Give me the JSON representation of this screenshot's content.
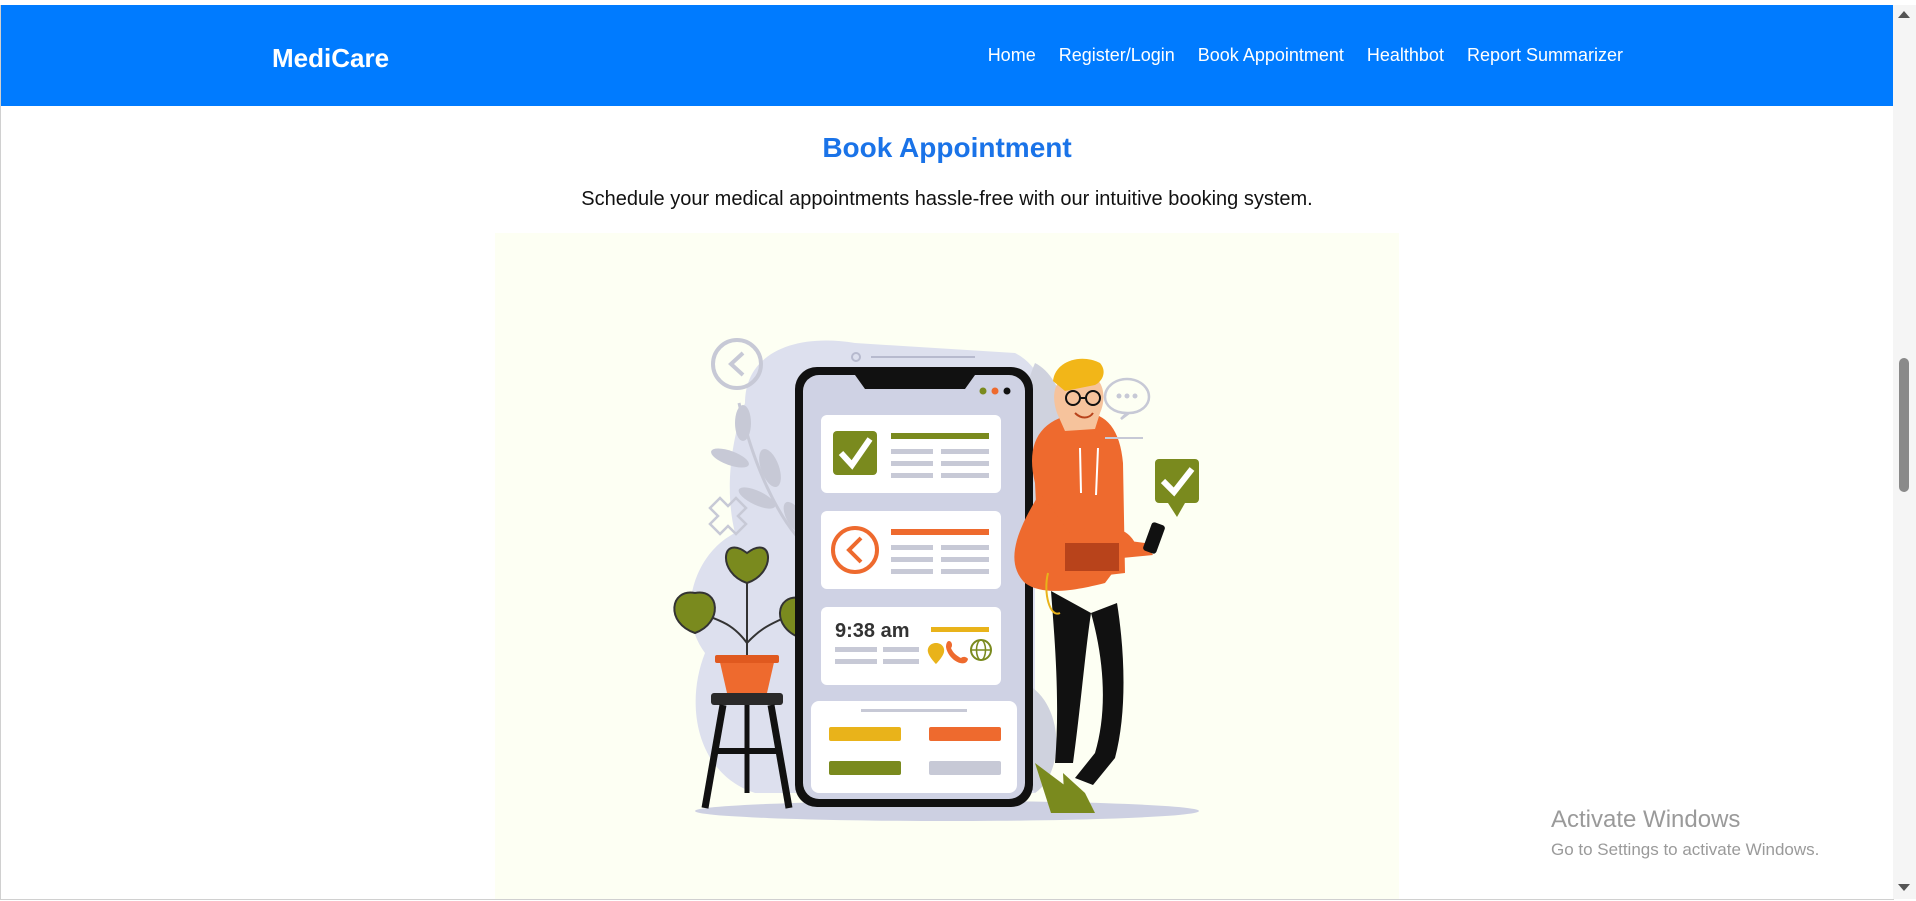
{
  "navbar": {
    "brand": "MediCare",
    "links": [
      "Home",
      "Register/Login",
      "Book Appointment",
      "Healthbot",
      "Report Summarizer"
    ]
  },
  "main": {
    "title": "Book Appointment",
    "subtitle": "Schedule your medical appointments hassle-free with our intuitive booking system."
  },
  "illustration": {
    "time_label": "9:38 am",
    "icons": [
      "clock-icon",
      "checkmark-icon",
      "location-pin-icon",
      "phone-icon",
      "globe-icon",
      "chat-bubble-icon",
      "plant-icon"
    ]
  },
  "watermark": {
    "title": "Activate Windows",
    "subtitle": "Go to Settings to activate Windows."
  },
  "colors": {
    "navbar": "#007bff",
    "title": "#1a73e8",
    "illustration_bg": "#fdfff3",
    "olive": "#7a8a1e",
    "orange": "#ee6a2e",
    "yellow": "#e9b31a"
  }
}
